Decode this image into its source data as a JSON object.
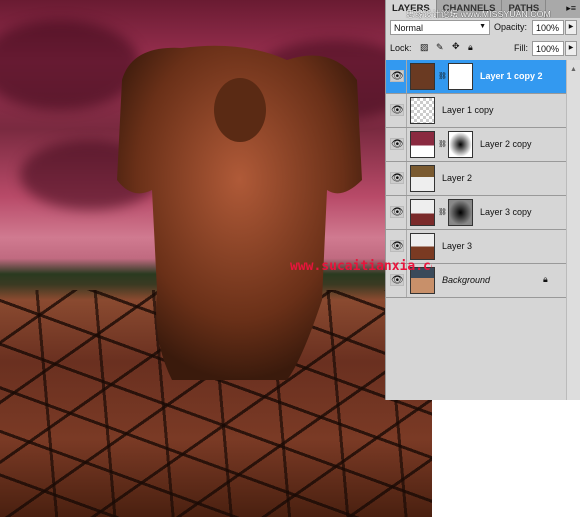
{
  "watermarks": {
    "top": "思缘设计论坛 www.MISSYUAN.COM",
    "canvas": "www.sucaitianxia.com"
  },
  "panel": {
    "tabs": [
      {
        "label": "LAYERS",
        "active": true
      },
      {
        "label": "CHANNELS",
        "active": false
      },
      {
        "label": "PATHS",
        "active": false
      }
    ],
    "blend_mode": "Normal",
    "opacity_label": "Opacity:",
    "opacity": "100%",
    "lock_label": "Lock:",
    "fill_label": "Fill:",
    "fill": "100%",
    "layers": [
      {
        "name": "Layer 1 copy 2",
        "selected": true,
        "mask": "white"
      },
      {
        "name": "Layer 1 copy"
      },
      {
        "name": "Layer 2 copy",
        "mask": "radial"
      },
      {
        "name": "Layer 2"
      },
      {
        "name": "Layer 3 copy",
        "mask": "radial"
      },
      {
        "name": "Layer 3"
      },
      {
        "name": "Background",
        "locked": true
      }
    ]
  },
  "colors": {
    "selection": "#3399f0",
    "panel": "#d6d6d6",
    "watermark": "#e8143c"
  }
}
